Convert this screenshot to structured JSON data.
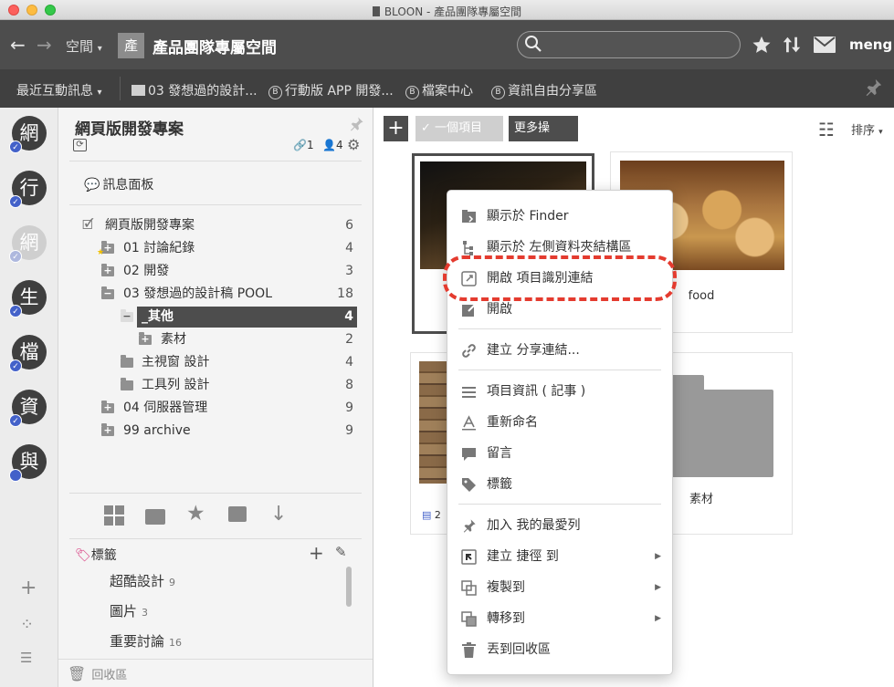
{
  "window": {
    "title": "BLOON - 產品團隊專屬空間"
  },
  "toolbar": {
    "space_dropdown": "空間",
    "space_badge": "產",
    "space_title": "產品團隊專屬空間",
    "search_placeholder": "",
    "user": "meng"
  },
  "bookmarks": {
    "recent": "最近互動訊息",
    "items": [
      {
        "label": "03 發想過的設計...",
        "kind": "folder"
      },
      {
        "label": "行動版 APP 開發...",
        "kind": "b"
      },
      {
        "label": "檔案中心",
        "kind": "b"
      },
      {
        "label": "資訊自由分享區",
        "kind": "b"
      }
    ]
  },
  "rail": {
    "items": [
      "網",
      "行",
      "網",
      "生",
      "檔",
      "資",
      "與"
    ]
  },
  "sidebar": {
    "project_title": "網頁版開發專案",
    "links_count": "1",
    "members_count": "4",
    "message_board": "訊息面板",
    "tree": [
      {
        "label": "網頁版開發專案",
        "count": "6"
      },
      {
        "label": "01 討論紀錄",
        "count": "4"
      },
      {
        "label": "02 開發",
        "count": "3"
      },
      {
        "label": "03 發想過的設計稿 POOL",
        "count": "18"
      },
      {
        "label": "_其他",
        "count": "4"
      },
      {
        "label": "素材",
        "count": "2"
      },
      {
        "label": "主視窗 設計",
        "count": "4"
      },
      {
        "label": "工具列 設計",
        "count": "8"
      },
      {
        "label": "04 伺服器管理",
        "count": "9"
      },
      {
        "label": "99 archive",
        "count": "9"
      }
    ],
    "tags_title": "標籤",
    "tags": [
      {
        "label": "超酷設計",
        "count": "9"
      },
      {
        "label": "圖片",
        "count": "3"
      },
      {
        "label": "重要討論",
        "count": "16"
      }
    ],
    "trash": "回收區"
  },
  "main": {
    "add_label": "+",
    "selected_label": "一個項目",
    "more_label": "更多操作...",
    "sort_label": "排序",
    "cards": [
      {
        "caption": "",
        "comments": ""
      },
      {
        "caption": "food",
        "comments": ""
      },
      {
        "caption": "",
        "comments": "2"
      },
      {
        "caption": "素材",
        "comments": ""
      }
    ]
  },
  "menu": {
    "items": [
      {
        "label": "顯示於 Finder",
        "icon": "finder-icon"
      },
      {
        "label": "顯示於 左側資料夾結構區",
        "icon": "tree-icon"
      },
      {
        "label": "開啟 項目識別連結",
        "icon": "link-open-icon"
      },
      {
        "label": "開啟",
        "icon": "open-icon"
      },
      {
        "label": "建立 分享連結...",
        "icon": "share-link-icon"
      },
      {
        "label": "項目資訊 ( 記事 )",
        "icon": "info-icon"
      },
      {
        "label": "重新命名",
        "icon": "rename-icon"
      },
      {
        "label": "留言",
        "icon": "comment-icon"
      },
      {
        "label": "標籤",
        "icon": "tag-icon"
      },
      {
        "label": "加入 我的最愛列",
        "icon": "pin-icon"
      },
      {
        "label": "建立 捷徑 到",
        "icon": "shortcut-icon"
      },
      {
        "label": "複製到",
        "icon": "copy-icon"
      },
      {
        "label": "轉移到",
        "icon": "move-icon"
      },
      {
        "label": "丟到回收區",
        "icon": "trash-icon"
      }
    ]
  },
  "colors": {
    "toolbar": "#4d4d4d",
    "bookmarks": "#404040",
    "accent": "#4361c9",
    "highlight_ring": "#e43b2f",
    "link_green": "#3a9a3a"
  }
}
